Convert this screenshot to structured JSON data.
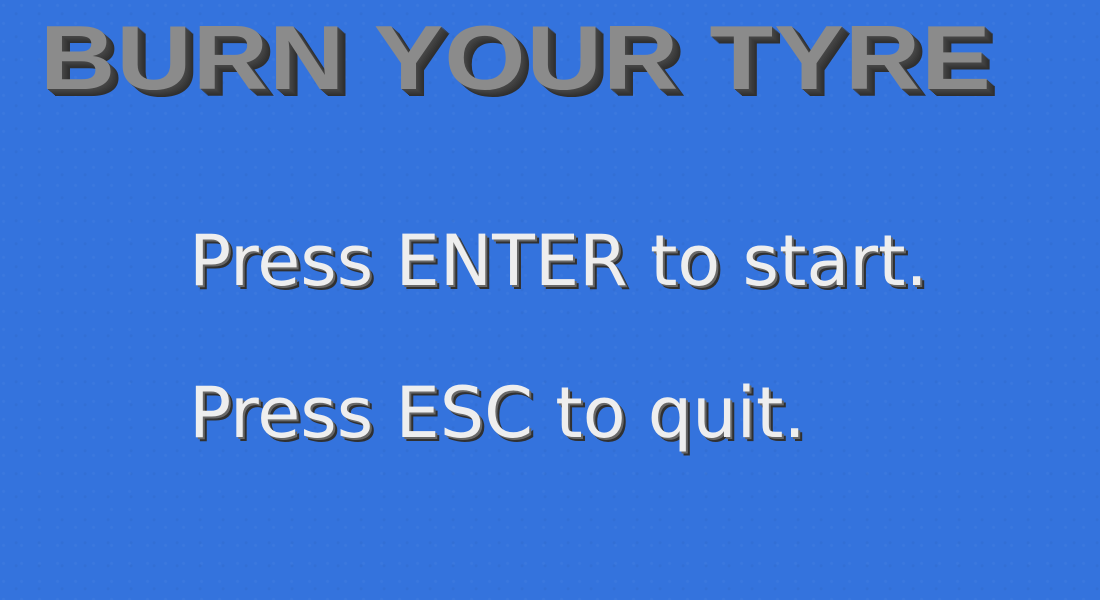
{
  "screen": {
    "background_color": "#3473dd",
    "title": "BURN YOUR TYRE",
    "instructions": {
      "start": "Press ENTER to start.",
      "quit": "Press ESC to quit."
    }
  },
  "colors": {
    "title": "#8b8b8b",
    "title_shadow": "#333333",
    "instruction_text": "#eeeeee",
    "instruction_shadow": "#303030"
  }
}
